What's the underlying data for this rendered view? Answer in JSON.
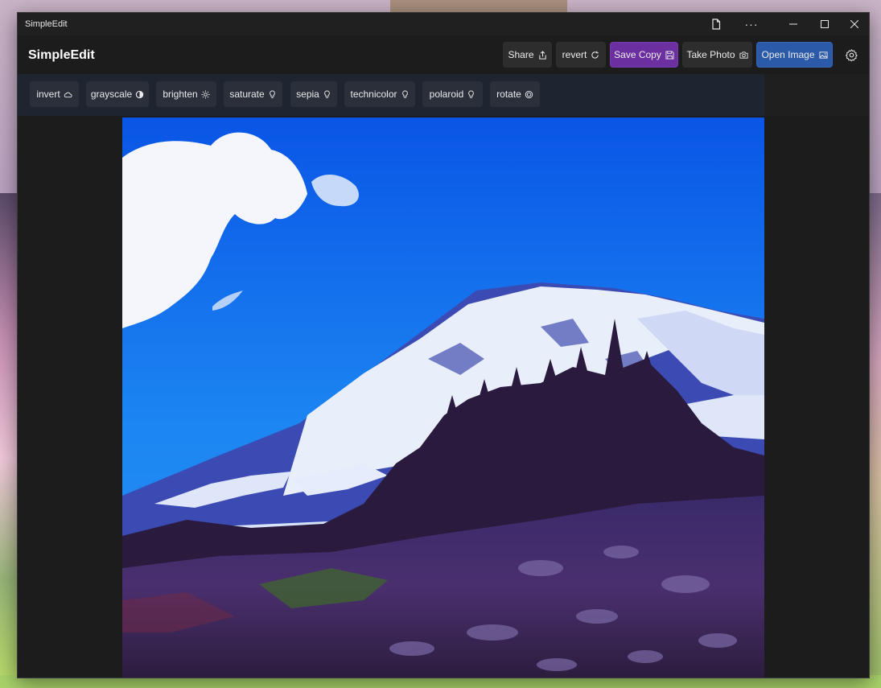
{
  "window": {
    "title": "SimpleEdit"
  },
  "titlebar": {
    "more_glyph": "···",
    "icons": [
      "document-icon",
      "more-icon",
      "minimize-icon",
      "maximize-icon",
      "close-icon"
    ]
  },
  "header": {
    "brand": "SimpleEdit",
    "buttons": {
      "share": "Share",
      "revert": "revert",
      "save_copy": "Save Copy",
      "take_photo": "Take Photo",
      "open_image": "Open Image"
    }
  },
  "filters": [
    {
      "label": "invert",
      "icon": "cloud-icon"
    },
    {
      "label": "grayscale",
      "icon": "contrast-icon"
    },
    {
      "label": "brighten",
      "icon": "sun-icon"
    },
    {
      "label": "saturate",
      "icon": "lightbulb-icon"
    },
    {
      "label": "sepia",
      "icon": "lightbulb-icon"
    },
    {
      "label": "technicolor",
      "icon": "lightbulb-icon"
    },
    {
      "label": "polaroid",
      "icon": "lightbulb-icon"
    },
    {
      "label": "rotate",
      "icon": "rotate-icon"
    }
  ],
  "colors": {
    "save_copy_accent": "#6b2fa0",
    "open_image_accent": "#2a5aa8",
    "window_bg": "#1c1c1c",
    "filter_bar_bg": "#1f2431"
  }
}
